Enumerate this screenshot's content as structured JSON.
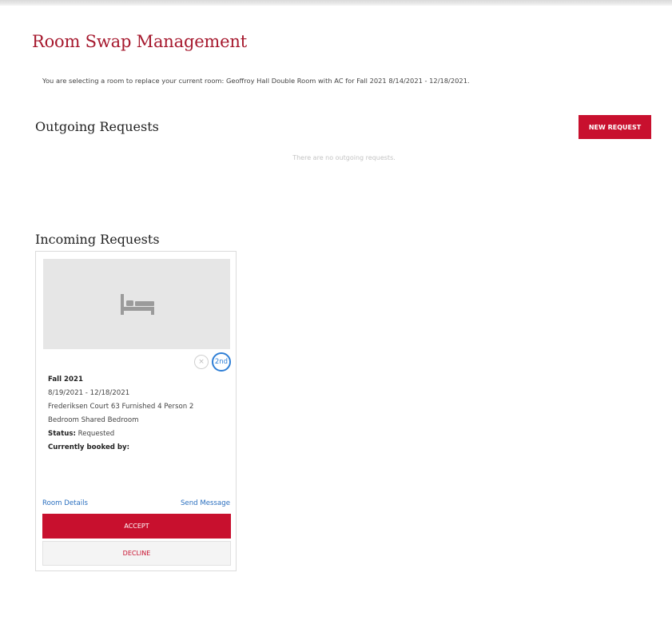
{
  "page": {
    "title": "Room Swap Management",
    "intro": "You are selecting a room to replace your current room: Geoffroy Hall Double Room with AC for Fall 2021 8/14/2021 - 12/18/2021."
  },
  "outgoing": {
    "heading": "Outgoing Requests",
    "new_request_label": "NEW REQUEST",
    "empty_message": "There are no outgoing requests."
  },
  "incoming": {
    "heading": "Incoming Requests",
    "cards": [
      {
        "image_icon": "bed-icon",
        "remove_chip": "×",
        "rank_chip": "2nd",
        "term": "Fall 2021",
        "dates": "8/19/2021 - 12/18/2021",
        "room_line1": "Frederiksen Court 63 Furnished 4 Person 2",
        "room_line2": "Bedroom Shared Bedroom",
        "status_label": "Status:",
        "status_value": "Requested",
        "booked_by_label": "Currently booked by:",
        "room_details_link": "Room Details",
        "send_message_link": "Send Message",
        "accept_label": "ACCEPT",
        "decline_label": "DECLINE"
      }
    ]
  },
  "colors": {
    "brand_red": "#c8102e",
    "title_red": "#a6192e",
    "link_blue": "#2a6fbf",
    "rank_blue": "#2f7fd6",
    "image_placeholder": "#e6e6e6"
  }
}
